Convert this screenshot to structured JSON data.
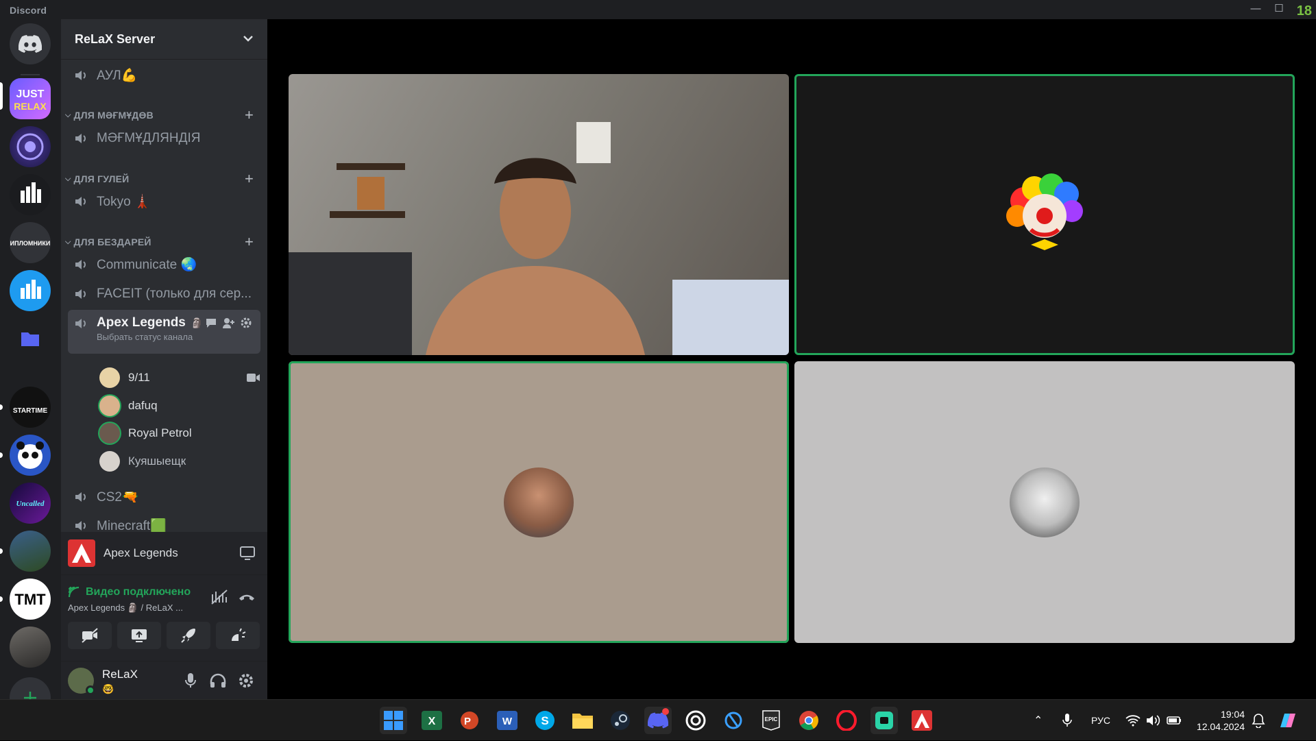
{
  "titlebar": {
    "app_name": "Discord",
    "badge": "18",
    "minimize": "—",
    "maximize": "☐"
  },
  "server": {
    "name": "ReLaX Server"
  },
  "channels": {
    "top": {
      "name": "АУЛ💪"
    },
    "categories": [
      {
        "name": "ДЛЯ МӘҒМҰДӨВ",
        "channels": [
          "МӘҒМҰДЛЯНДІЯ"
        ]
      },
      {
        "name": "ДЛЯ ГУЛЕЙ",
        "channels": [
          "Tokyo 🗼"
        ]
      },
      {
        "name": "ДЛЯ БЕЗДАРЕЙ",
        "channels": [
          "Communicate 🌏",
          "FACEIT (только для сер..."
        ]
      }
    ],
    "active": {
      "name": "Apex Legends",
      "status": "Выбрать статус канала"
    },
    "members": [
      "9/11",
      "dafuq",
      "Royal Petrol",
      "Куяшыещк"
    ],
    "after": [
      "CS2🔫",
      "Minecraft🟩"
    ]
  },
  "activity": {
    "game": "Apex Legends"
  },
  "voice": {
    "status": "Видео подключено",
    "location": "Apex Legends 🗿 / ReLaX ..."
  },
  "user": {
    "name": "ReLaX",
    "status_emoji": "🤓"
  },
  "taskbar": {
    "lang": "РУС",
    "time": "19:04",
    "date": "12.04.2024",
    "apps": [
      "start",
      "excel",
      "powerpoint",
      "word",
      "skype",
      "explorer",
      "steam",
      "discord",
      "ubisoft",
      "battlenet",
      "epic",
      "chrome",
      "opera",
      "roblox",
      "apex"
    ]
  },
  "colors": {
    "speaking": "#23a55a",
    "accent": "#5865f2"
  }
}
